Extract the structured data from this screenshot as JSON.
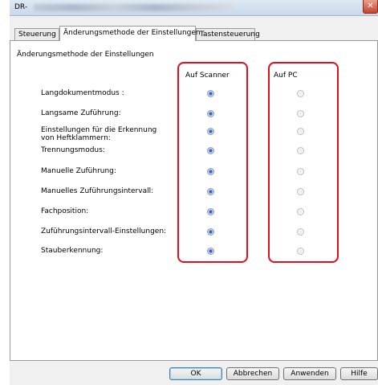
{
  "window": {
    "title": "DR-"
  },
  "tabs": [
    {
      "label": "Steuerung",
      "active": false
    },
    {
      "label": "Änderungsmethode der Einstellungen",
      "active": true
    },
    {
      "label": "Tastensteuerung",
      "active": false
    }
  ],
  "panel": {
    "section_title": "Änderungsmethode der Einstellungen",
    "columns": {
      "scanner": "Auf Scanner",
      "pc": "Auf PC"
    },
    "rows": [
      {
        "label": "Langdokumentmodus :",
        "selected": "scanner"
      },
      {
        "label": "Langsame Zuführung:",
        "selected": "scanner"
      },
      {
        "label": "Einstellungen für die Erkennung von Heftklammern:",
        "selected": "scanner"
      },
      {
        "label": "Trennungsmodus:",
        "selected": "scanner"
      },
      {
        "label": "Manuelle Zuführung:",
        "selected": "scanner"
      },
      {
        "label": "Manuelles Zuführungsintervall:",
        "selected": "scanner"
      },
      {
        "label": "Fachposition:",
        "selected": "scanner"
      },
      {
        "label": "Zuführungsintervall-Einstellungen:",
        "selected": "scanner"
      },
      {
        "label": "Stauberkennung:",
        "selected": "scanner"
      }
    ]
  },
  "buttons": {
    "ok": "OK",
    "cancel": "Abbrechen",
    "apply": "Anwenden",
    "help": "Hilfe"
  },
  "colors": {
    "highlight_box": "#e0101a",
    "close_button": "#c4432d"
  },
  "icons": {
    "close": "close-icon",
    "radio_selected": "radio-selected",
    "radio_unselected": "radio-unselected"
  }
}
